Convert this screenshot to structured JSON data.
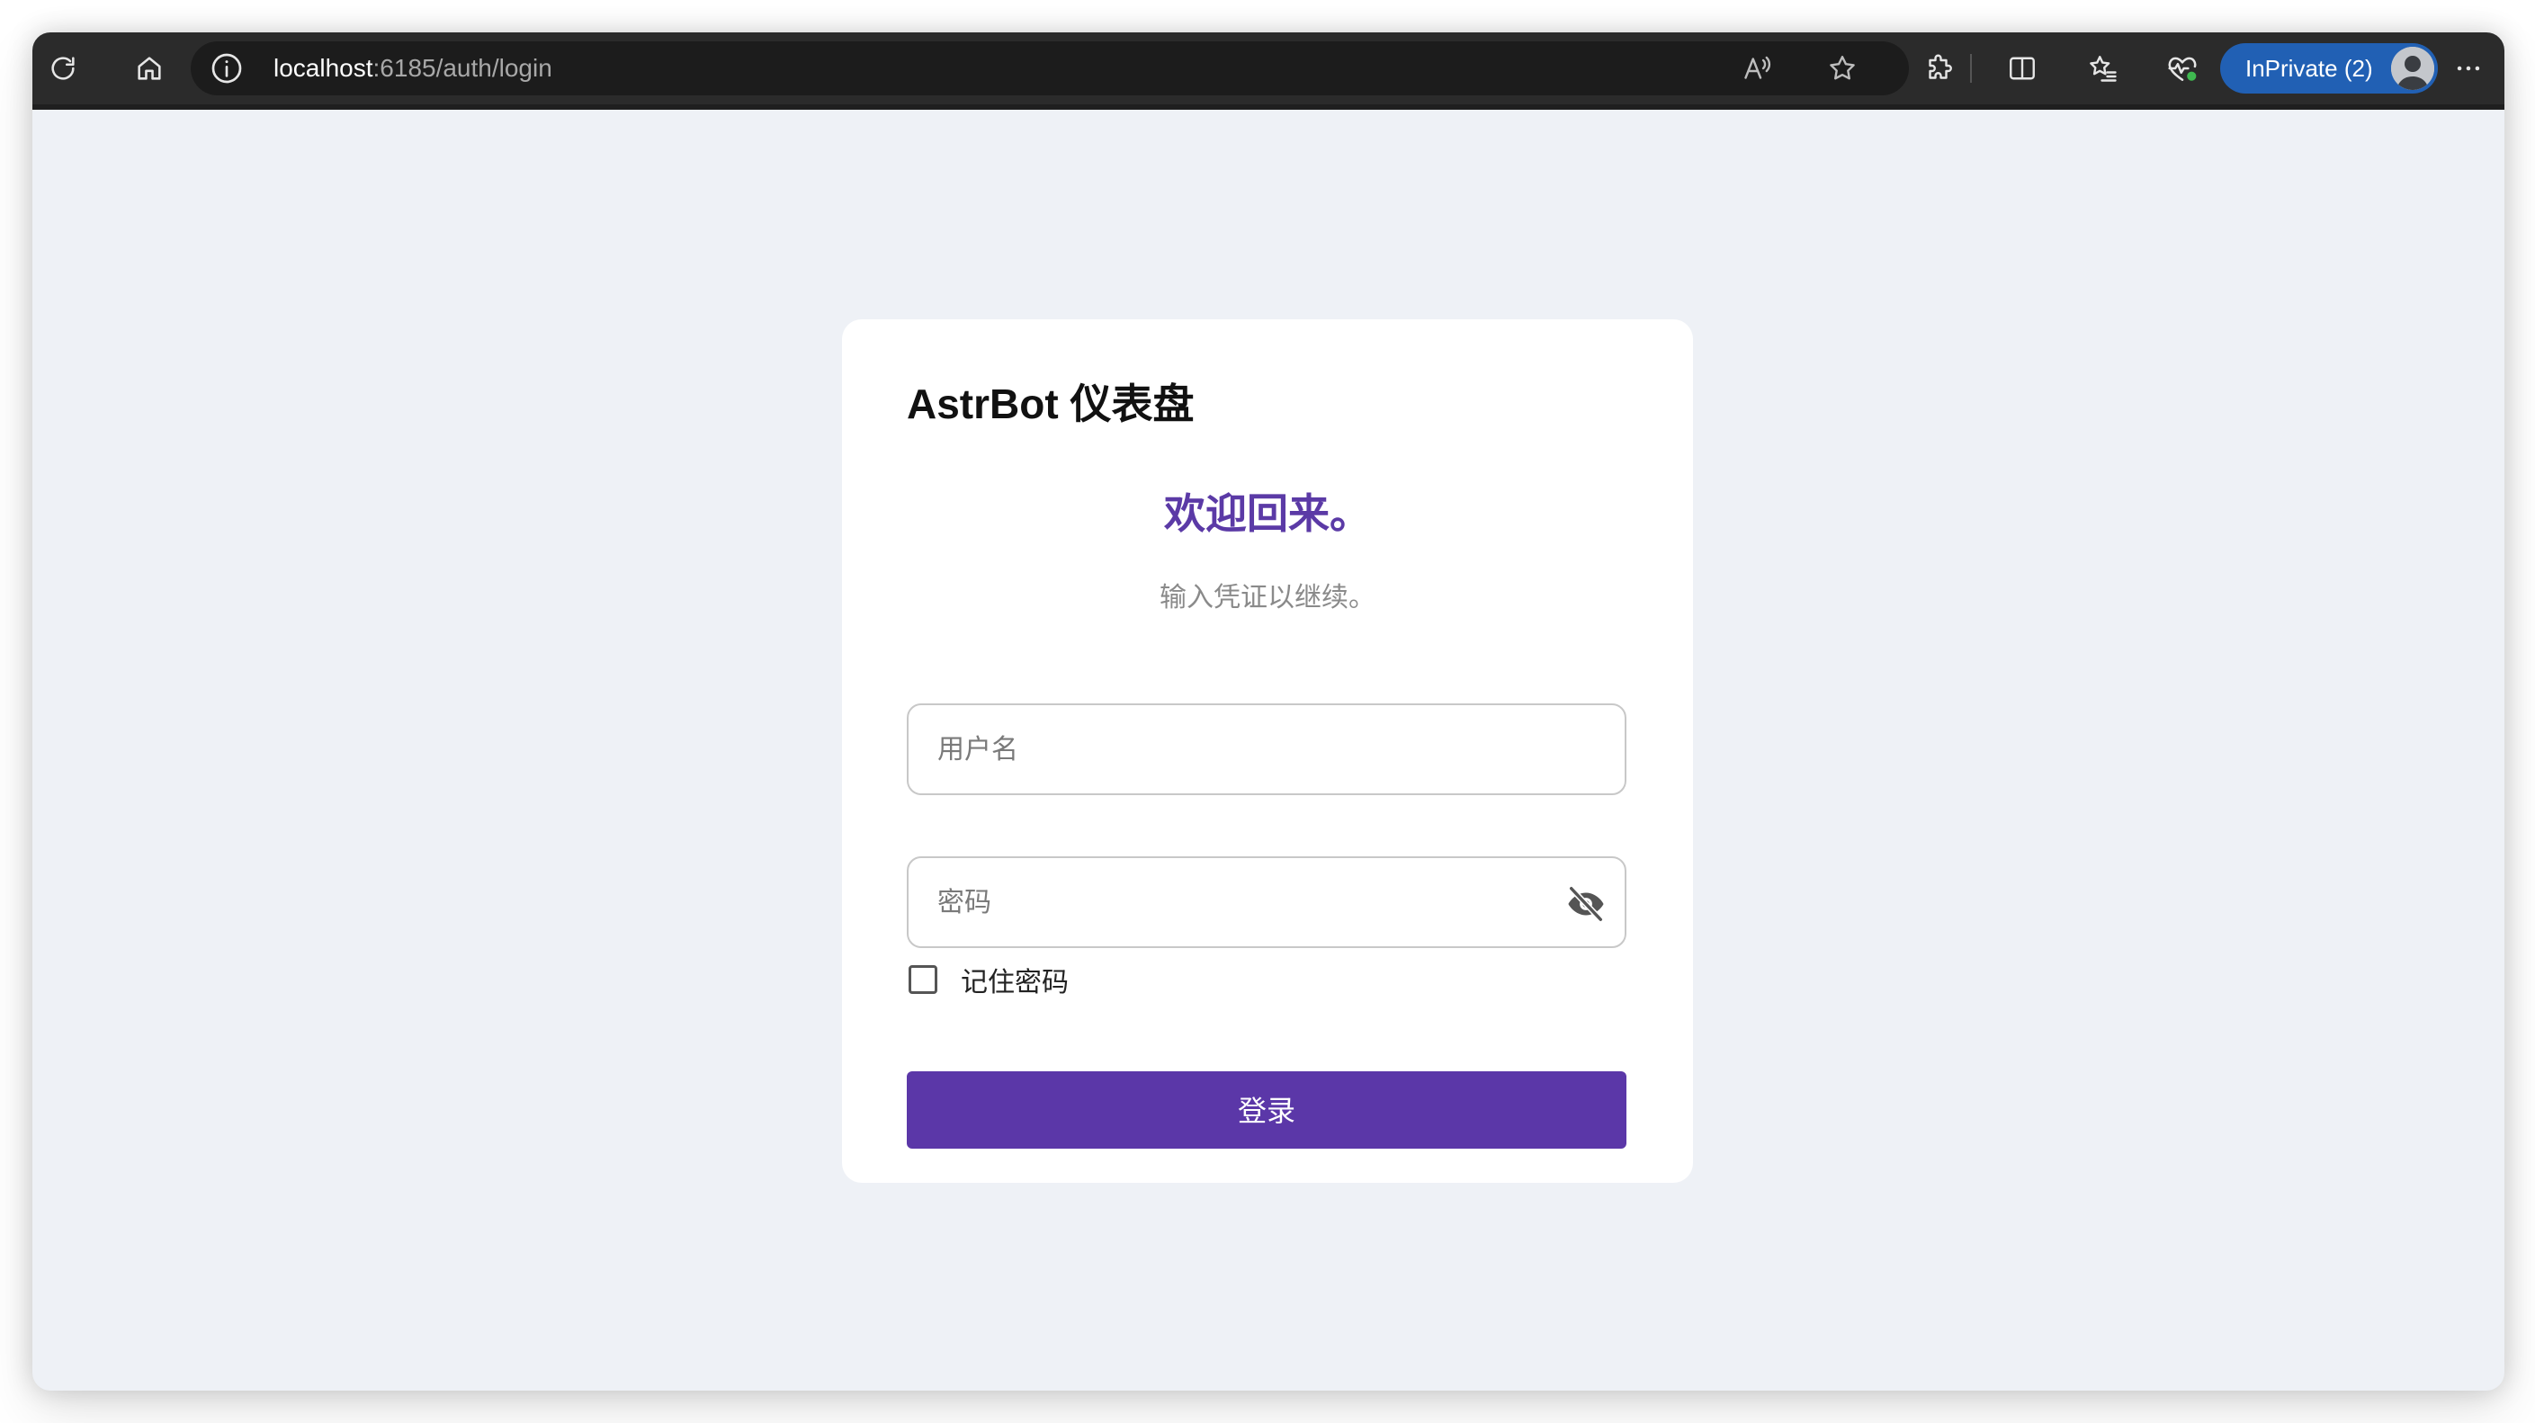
{
  "browser": {
    "url_host": "localhost",
    "url_rest": ":6185/auth/login",
    "inprivate_label": "InPrivate (2)",
    "icons": {
      "reload": "reload-icon",
      "home": "home-icon",
      "site_info": "info-icon",
      "read_aloud": "read-aloud-icon",
      "favorite": "star-icon",
      "extensions": "puzzle-icon",
      "split_screen": "split-screen-icon",
      "favorites": "favorites-icon",
      "browser_essentials": "heartbeat-icon",
      "more": "more-icon"
    }
  },
  "login": {
    "brand": "AstrBot 仪表盘",
    "welcome": "欢迎回来。",
    "subtitle": "输入凭证以继续。",
    "username_placeholder": "用户名",
    "username_value": "",
    "password_placeholder": "密码",
    "password_value": "",
    "remember_label": "记住密码",
    "remember_checked": false,
    "submit_label": "登录"
  },
  "colors": {
    "accent": "#5b37a8",
    "welcome_text": "#5b3aa6",
    "page_background": "#eef1f6",
    "toolbar": "#2b2b2b",
    "inprivate": "#2160b4"
  }
}
